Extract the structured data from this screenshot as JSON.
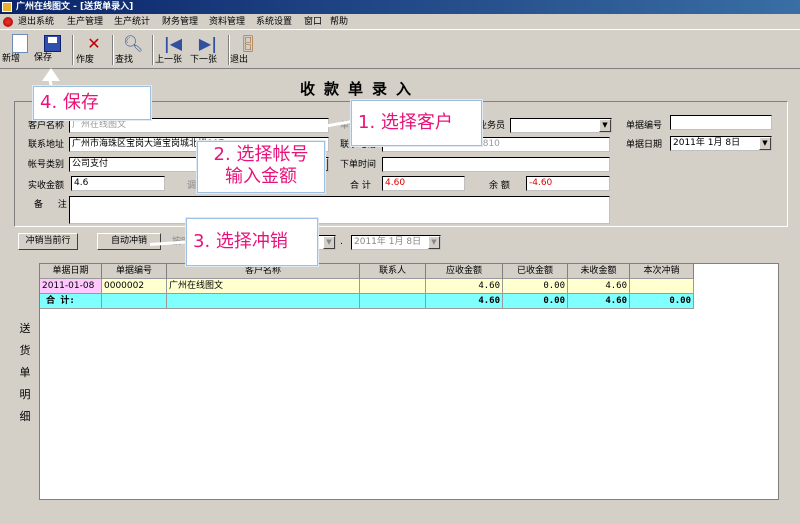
{
  "window": {
    "title": "广州在线图文 - [送货单录入]"
  },
  "menu": [
    "退出系统",
    "生产管理",
    "生产统计",
    "财务管理",
    "资料管理",
    "系统设置",
    "窗口",
    "帮助"
  ],
  "toolbar": {
    "new": "新增",
    "save": "保存",
    "void": "作废",
    "find": "查找",
    "prev": "上一张",
    "next": "下一张",
    "exit": "退出"
  },
  "form": {
    "title": "收款单录入",
    "customer_name_label": "客户名称",
    "customer_name_value": "广州在线图文",
    "unit_label": "单位",
    "salesman_label": "业务员",
    "salesman_value": "",
    "order_no_label": "单据编号",
    "order_no_value": "",
    "address_label": "联系地址",
    "address_value": "广州市海珠区宝岗大道宝岗城北楼007",
    "phone_label": "联系电话",
    "phone_value": "020-34382731,34322810",
    "order_date_label": "单据日期",
    "order_date_value": "2011年 1月 8日",
    "account_type_label": "帐号类别",
    "account_type_value": "公司支付",
    "order_time_label": "下单时间",
    "order_time_value": "",
    "received_label": "实收金额",
    "received_value": "4.6",
    "adjust_label": "调整金额",
    "total_label": "合 计",
    "total_value": "4.60",
    "balance_label": "余 额",
    "balance_value": "-4.60",
    "remark_label": "备 注",
    "remark_value": ""
  },
  "writeoff": {
    "current_button": "冲销当前行",
    "auto_button": "自动冲销",
    "by_time_label": "按时间",
    "date_sep": ".",
    "date_to": "2011年 1月 8日"
  },
  "grid": {
    "side_label": [
      "送",
      "货",
      "单",
      "明",
      "细"
    ],
    "columns": [
      "单据日期",
      "单据编号",
      "客户名称",
      "联系人",
      "应收金额",
      "已收金额",
      "未收金额",
      "本次冲销"
    ],
    "rows": [
      [
        "2011-01-08",
        "0000002",
        "广州在线图文",
        "",
        "4.60",
        "0.00",
        "4.60",
        ""
      ]
    ],
    "total_row": [
      "合 计:",
      "",
      "",
      "",
      "4.60",
      "0.00",
      "4.60",
      "0.00"
    ]
  },
  "callouts": {
    "save": "4. 保存",
    "customer": "1. 选择客户",
    "account_line1": "2. 选择帐号",
    "account_line2": "输入金额",
    "writeoff": "3. 选择冲销"
  }
}
